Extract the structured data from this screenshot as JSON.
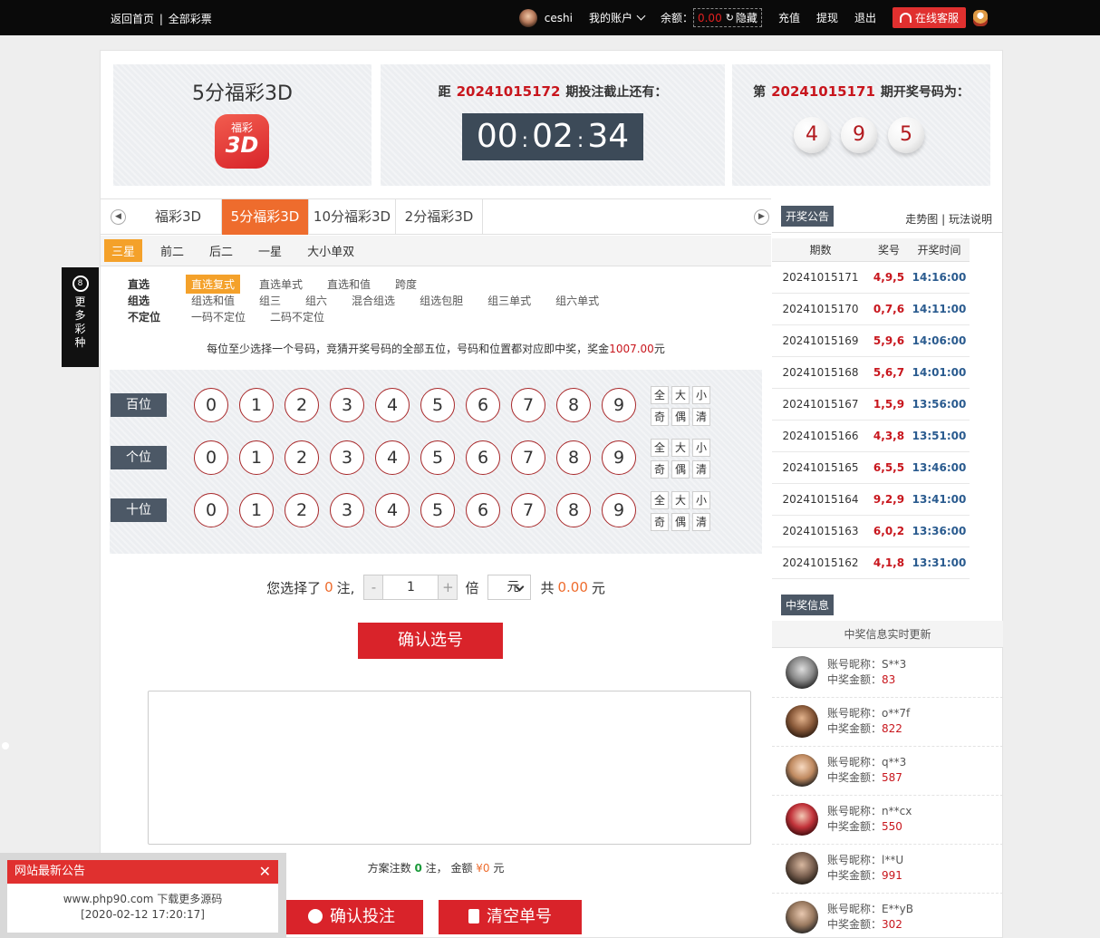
{
  "topbar": {
    "home": "返回首页",
    "sep": "|",
    "all_lottery": "全部彩票",
    "username": "ceshi",
    "account": "我的账户",
    "balance_label": "余额：",
    "balance_value": "0.00",
    "hide": "隐藏",
    "recharge": "充值",
    "withdraw": "提现",
    "logout": "退出",
    "service": "在线客服"
  },
  "header": {
    "lottery_name": "5分福彩3D",
    "logo_top": "福彩",
    "logo_main": "3D",
    "countdown_pre": "距",
    "countdown_issue": "20241015172",
    "countdown_post": "期投注截止还有：",
    "timer_h": "00",
    "timer_m": "02",
    "timer_s": "34",
    "timer_sep": ":",
    "last_pre": "第",
    "last_issue": "20241015171",
    "last_post": "期开奖号码为：",
    "balls": [
      "4",
      "9",
      "5"
    ]
  },
  "nav": {
    "prev": "◀",
    "next": "▶",
    "tabs": [
      "福彩3D",
      "5分福彩3D",
      "10分福彩3D",
      "2分福彩3D"
    ],
    "subtabs": [
      "三星",
      "前二",
      "后二",
      "一星",
      "大小单双"
    ]
  },
  "modes": {
    "row1_label": "直选",
    "row1": [
      "直选复式",
      "直选单式",
      "直选和值",
      "跨度"
    ],
    "row2_label": "组选",
    "row2": [
      "组选和值",
      "组三",
      "组六",
      "混合组选",
      "组选包胆",
      "组三单式",
      "组六单式"
    ],
    "row3_label": "不定位",
    "row3": [
      "一码不定位",
      "二码不定位"
    ]
  },
  "tip": {
    "text": "每位至少选择一个号码，竞猜开奖号码的全部五位，号码和位置都对应即中奖，奖金",
    "amount": "1007.00",
    "unit": "元"
  },
  "positions": [
    "百位",
    "个位",
    "十位"
  ],
  "digits": [
    "0",
    "1",
    "2",
    "3",
    "4",
    "5",
    "6",
    "7",
    "8",
    "9"
  ],
  "quick": [
    "全",
    "大",
    "小",
    "奇",
    "偶",
    "清"
  ],
  "bet": {
    "pre": "您选择了",
    "count": "0",
    "zhu": "注,",
    "minus": "-",
    "qty": "1",
    "plus": "+",
    "bei": "倍",
    "unit_sel": "元",
    "total_pre": "共",
    "total": "0.00",
    "total_unit": "元",
    "confirm": "确认选号"
  },
  "summary": {
    "pre": "方案注数",
    "count": "0",
    "mid": "注， 金额",
    "amount": "¥0",
    "unit": "元"
  },
  "actions": {
    "submit": "确认投注",
    "clear": "清空单号"
  },
  "history": {
    "pill": "开奖公告",
    "trend": "走势图",
    "sep": "|",
    "rules": "玩法说明",
    "headers": [
      "期数",
      "奖号",
      "开奖时间"
    ],
    "rows": [
      [
        "20241015171",
        "4,9,5",
        "14:16:00"
      ],
      [
        "20241015170",
        "0,7,6",
        "14:11:00"
      ],
      [
        "20241015169",
        "5,9,6",
        "14:06:00"
      ],
      [
        "20241015168",
        "5,6,7",
        "14:01:00"
      ],
      [
        "20241015167",
        "1,5,9",
        "13:56:00"
      ],
      [
        "20241015166",
        "4,3,8",
        "13:51:00"
      ],
      [
        "20241015165",
        "6,5,5",
        "13:46:00"
      ],
      [
        "20241015164",
        "9,2,9",
        "13:41:00"
      ],
      [
        "20241015163",
        "6,0,2",
        "13:36:00"
      ],
      [
        "20241015162",
        "4,1,8",
        "13:31:00"
      ]
    ]
  },
  "winners": {
    "pill": "中奖信息",
    "sub": "中奖信息实时更新",
    "nick_label": "账号昵称：",
    "amount_label": "中奖金额：",
    "items": [
      {
        "nick": "S**3",
        "amount": "83"
      },
      {
        "nick": "o**7f",
        "amount": "822"
      },
      {
        "nick": "q**3",
        "amount": "587"
      },
      {
        "nick": "n**cx",
        "amount": "550"
      },
      {
        "nick": "l**U",
        "amount": "991"
      },
      {
        "nick": "E**yB",
        "amount": "302"
      }
    ]
  },
  "side": {
    "badge": "8",
    "text": [
      "更",
      "多",
      "彩",
      "种"
    ]
  },
  "notice": {
    "title": "网站最新公告",
    "close": "✕",
    "line1": "www.php90.com 下载更多源码",
    "line2": "[2020-02-12 17:20:17]"
  }
}
